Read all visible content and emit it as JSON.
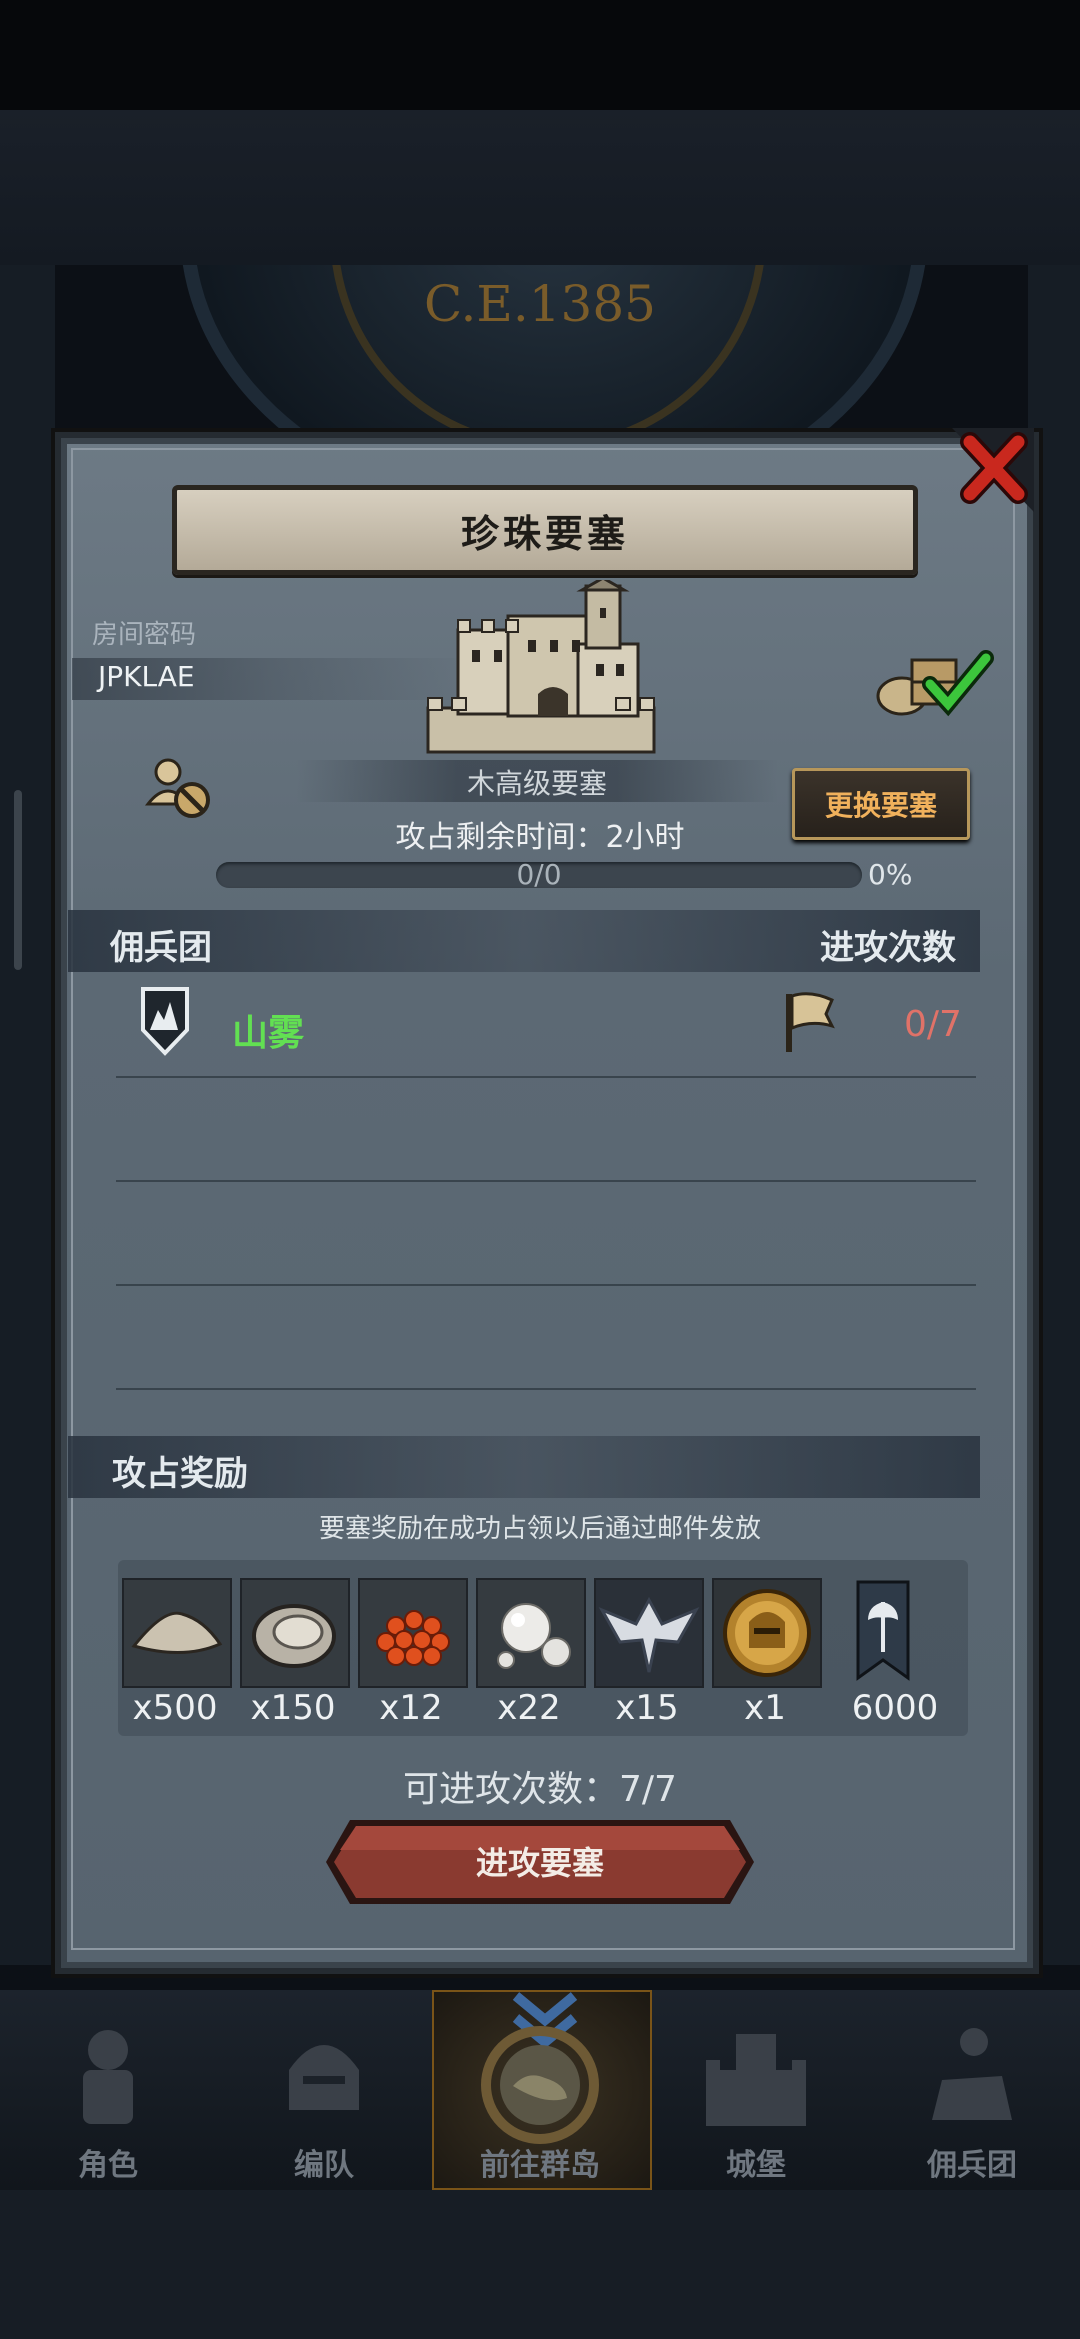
{
  "header": {
    "era": "C.E.1385"
  },
  "dialog": {
    "title": "珍珠要塞",
    "room": {
      "label": "房间密码",
      "code": "JPKLAE"
    },
    "fortress_tier": "木高级要塞",
    "swap_button": "更换要塞",
    "time_remaining": "攻占剩余时间：2小时",
    "progress": {
      "text": "0/0",
      "percent_label": "0%",
      "fraction": 0
    },
    "mercenary_section": {
      "title": "佣兵团",
      "attacks_header": "进攻次数"
    },
    "mercenaries": [
      {
        "name": "山雾",
        "attacks": "0/7"
      }
    ],
    "reward_section": {
      "title": "攻占奖励",
      "note": "要塞奖励在成功占领以后通过邮件发放"
    },
    "rewards": [
      {
        "icon": "sand-pile-icon",
        "qty": "x500"
      },
      {
        "icon": "oyster-shell-icon",
        "qty": "x150"
      },
      {
        "icon": "fish-roe-icon",
        "qty": "x12"
      },
      {
        "icon": "pearls-icon",
        "qty": "x22"
      },
      {
        "icon": "winged-crest-icon",
        "qty": "x15"
      },
      {
        "icon": "gold-helmet-medal-icon",
        "qty": "x1"
      },
      {
        "icon": "axe-banner-icon",
        "qty": "6000"
      }
    ],
    "attempts": "可进攻次数：7/7",
    "attack_button": "进攻要塞"
  },
  "nav": {
    "items": [
      {
        "label": "角色",
        "icon": "knight-icon"
      },
      {
        "label": "编队",
        "icon": "helmet-icon"
      },
      {
        "label": "前往群岛",
        "icon": "island-compass-icon",
        "active": true
      },
      {
        "label": "城堡",
        "icon": "castle-icon"
      },
      {
        "label": "佣兵团",
        "icon": "horseman-icon"
      }
    ]
  },
  "colors": {
    "accent": "#f0b15c",
    "positive": "#62e052",
    "danger": "#e07268",
    "panel": "#5e6b76"
  }
}
